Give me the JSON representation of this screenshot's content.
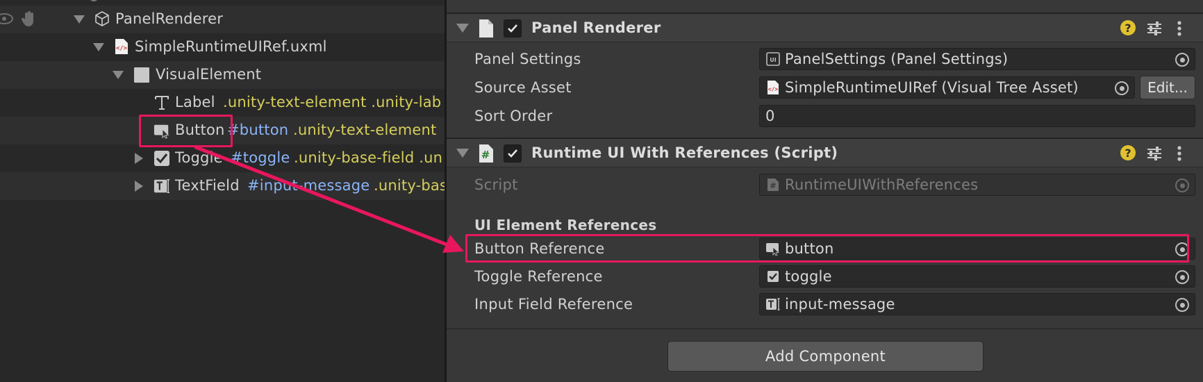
{
  "hierarchy": {
    "rows": [
      {
        "label": "PanelRenderer"
      },
      {
        "label": "SimpleRuntimeUIRef.uxml"
      },
      {
        "label": "VisualElement"
      },
      {
        "label": "Label",
        "classes": ".unity-text-element .unity-lab"
      },
      {
        "label": "Button",
        "id": "#button",
        "classes": ".unity-text-element"
      },
      {
        "label": "Toggle",
        "id": "#toggle",
        "classes": ".unity-base-field .un"
      },
      {
        "label": "TextField",
        "id": "#input-message",
        "classes": ".unity-bas"
      }
    ]
  },
  "inspector": {
    "panel_renderer": {
      "title": "Panel Renderer",
      "props": {
        "panel_settings_label": "Panel Settings",
        "panel_settings_value": "PanelSettings (Panel Settings)",
        "source_asset_label": "Source Asset",
        "source_asset_value": "SimpleRuntimeUIRef (Visual Tree Asset)",
        "edit_label": "Edit...",
        "sort_order_label": "Sort Order",
        "sort_order_value": "0"
      }
    },
    "runtime_script": {
      "title": "Runtime UI With References (Script)",
      "script_label": "Script",
      "script_value": "RuntimeUIWithReferences",
      "section_title": "UI Element References",
      "button_ref_label": "Button Reference",
      "button_ref_value": "button",
      "toggle_ref_label": "Toggle Reference",
      "toggle_ref_value": "toggle",
      "input_ref_label": "Input Field Reference",
      "input_ref_value": "input-message"
    },
    "add_component_label": "Add Component",
    "help_glyph": "?"
  },
  "colors": {
    "highlight": "#e8175d",
    "help_icon": "#e1c22e",
    "id_text": "#8ab4f8",
    "class_text": "#d6cf5b"
  }
}
